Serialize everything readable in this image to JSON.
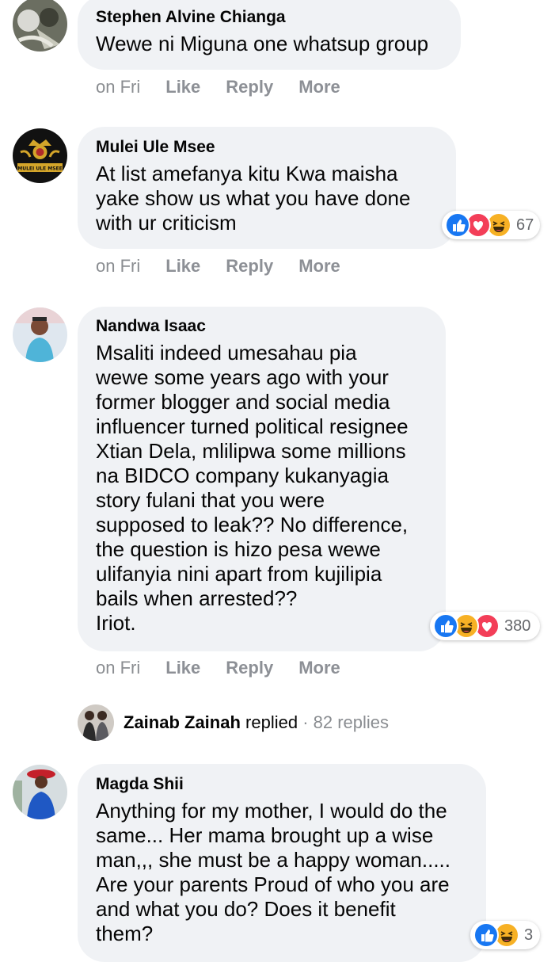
{
  "comments": [
    {
      "name": "Stephen Alvine Chianga",
      "text": "Wewe ni Miguna one whatsup group",
      "time": "on Fri",
      "like": "Like",
      "reply": "Reply",
      "more": "More"
    },
    {
      "name": "Mulei Ule Msee",
      "avatar_text": "MULEI ULE MSEE",
      "text": "At list amefanya kitu Kwa maisha\nyake show us what you have done\nwith ur criticism",
      "reaction_count": "67",
      "reactions": [
        "like-icon",
        "love-icon",
        "haha-icon"
      ],
      "time": "on Fri",
      "like": "Like",
      "reply": "Reply",
      "more": "More"
    },
    {
      "name": "Nandwa Isaac",
      "text": "Msaliti indeed umesahau pia\nwewe some years ago with your\nformer blogger and social media\ninfluencer turned political resignee\nXtian Dela, mlilipwa some millions\nna BIDCO company kukanyagia\nstory fulani that you were\nsupposed to leak?? No difference,\nthe question is hizo pesa wewe\nulifanyia nini apart from kujilipia\nbails when arrested??\nIriot.",
      "reaction_count": "380",
      "reactions": [
        "like-icon",
        "haha-icon",
        "love-icon"
      ],
      "time": "on Fri",
      "like": "Like",
      "reply": "Reply",
      "more": "More"
    },
    {
      "name": "Magda Shii",
      "text": "Anything for my mother, I would do the\nsame... Her mama brought up a wise\nman,,, she must be a happy woman.....\nAre your parents Proud of who you are\nand what you do? Does it benefit\nthem?",
      "reaction_count": "3",
      "reactions": [
        "like-icon",
        "haha-icon"
      ]
    }
  ],
  "reply_summary": {
    "name": "Zainab Zainah",
    "verb": " replied",
    "count": " · 82 replies"
  },
  "colors": {
    "bubble": "#f0f2f5",
    "like_blue": "#1877f2",
    "love_red": "#f33e58",
    "haha_yellow": "#f7b125",
    "muted": "#8a8d91"
  }
}
